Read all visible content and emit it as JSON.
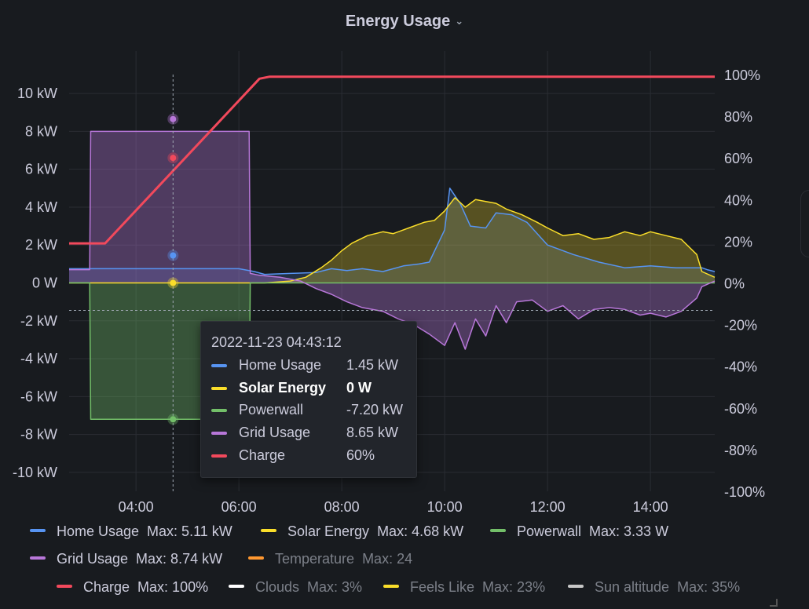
{
  "panel": {
    "title": "Energy Usage"
  },
  "chart_data": {
    "type": "line",
    "x_ticks": [
      "04:00",
      "06:00",
      "08:00",
      "10:00",
      "12:00",
      "14:00"
    ],
    "x_tick_hours": [
      4,
      6,
      8,
      10,
      12,
      14
    ],
    "x_range": [
      2.7,
      15.25
    ],
    "y_left": {
      "ticks": [
        "10 kW",
        "8 kW",
        "6 kW",
        "4 kW",
        "2 kW",
        "0 W",
        "-2 kW",
        "-4 kW",
        "-6 kW",
        "-8 kW",
        "-10 kW"
      ],
      "range_kw": [
        -11,
        11
      ]
    },
    "y_right": {
      "ticks": [
        "100%",
        "80%",
        "60%",
        "40%",
        "20%",
        "0%",
        "-20%",
        "-40%",
        "-60%",
        "-80%",
        "-100%"
      ],
      "range_pct": [
        -100,
        100
      ]
    },
    "hover_hour": 4.72,
    "hover_threshold_kw": -1.45,
    "series": [
      {
        "name": "Home Usage",
        "color": "#5794f2",
        "unit": "kW",
        "x": [
          2.7,
          3.1,
          3.2,
          4.0,
          5.0,
          6.0,
          6.3,
          6.5,
          7.0,
          7.5,
          7.8,
          8.1,
          8.4,
          8.8,
          9.2,
          9.5,
          9.7,
          10.0,
          10.1,
          10.3,
          10.5,
          10.8,
          11.0,
          11.3,
          11.6,
          12.0,
          12.5,
          13.0,
          13.5,
          14.0,
          14.5,
          14.8,
          15.0,
          15.1,
          15.25
        ],
        "y": [
          0.75,
          0.75,
          0.75,
          0.75,
          0.75,
          0.75,
          0.6,
          0.45,
          0.5,
          0.55,
          0.75,
          0.65,
          0.75,
          0.6,
          0.9,
          1.0,
          1.1,
          2.8,
          5.0,
          4.2,
          3.0,
          2.9,
          3.7,
          3.6,
          3.2,
          2.0,
          1.5,
          1.1,
          0.8,
          0.9,
          0.8,
          0.8,
          0.8,
          0.7,
          0.6
        ]
      },
      {
        "name": "Solar Energy",
        "color": "#fade2a",
        "unit": "kW",
        "x": [
          2.7,
          6.5,
          7.0,
          7.3,
          7.6,
          7.8,
          8.0,
          8.2,
          8.5,
          8.8,
          9.0,
          9.3,
          9.6,
          9.8,
          10.0,
          10.2,
          10.4,
          10.6,
          10.8,
          11.0,
          11.2,
          11.5,
          11.8,
          12.0,
          12.3,
          12.6,
          12.9,
          13.2,
          13.5,
          13.8,
          14.0,
          14.3,
          14.6,
          14.9,
          15.0,
          15.25
        ],
        "y": [
          0,
          0,
          0.1,
          0.3,
          0.8,
          1.2,
          1.7,
          2.1,
          2.5,
          2.7,
          2.6,
          2.9,
          3.2,
          3.3,
          3.8,
          4.5,
          4.0,
          4.4,
          4.3,
          4.2,
          3.9,
          3.6,
          3.2,
          2.9,
          2.5,
          2.6,
          2.3,
          2.4,
          2.7,
          2.5,
          2.7,
          2.5,
          2.3,
          1.5,
          0.6,
          0.3
        ]
      },
      {
        "name": "Powerwall",
        "color": "#73bf69",
        "unit": "kW",
        "x": [
          2.7,
          3.1,
          3.12,
          6.2,
          6.22,
          15.25
        ],
        "y": [
          0,
          0,
          -7.2,
          -7.2,
          0,
          0
        ]
      },
      {
        "name": "Grid Usage",
        "color": "#b877d9",
        "unit": "kW",
        "x": [
          2.7,
          3.1,
          3.12,
          6.2,
          6.22,
          6.4,
          6.8,
          7.2,
          7.5,
          7.8,
          8.1,
          8.4,
          8.8,
          9.1,
          9.4,
          9.7,
          10.0,
          10.2,
          10.4,
          10.6,
          10.8,
          11.0,
          11.2,
          11.4,
          11.7,
          12.0,
          12.3,
          12.6,
          12.9,
          13.2,
          13.5,
          13.8,
          14.0,
          14.3,
          14.6,
          14.9,
          15.0,
          15.25
        ],
        "y": [
          0.7,
          0.7,
          8.0,
          8.0,
          0.5,
          0.4,
          0.3,
          0.1,
          -0.3,
          -0.6,
          -1.0,
          -1.3,
          -1.5,
          -1.9,
          -2.2,
          -2.7,
          -3.3,
          -2.1,
          -3.5,
          -1.9,
          -2.8,
          -1.2,
          -2.1,
          -1.0,
          -0.9,
          -1.5,
          -1.2,
          -1.9,
          -1.4,
          -1.3,
          -1.4,
          -1.7,
          -1.6,
          -1.8,
          -1.5,
          -0.8,
          -0.2,
          0.1
        ]
      },
      {
        "name": "Charge",
        "color": "#f2495c",
        "unit": "%",
        "axis": "right",
        "x": [
          2.7,
          3.4,
          6.4,
          6.6,
          7.0,
          15.25
        ],
        "y": [
          19,
          19,
          98,
          99,
          99,
          99
        ]
      }
    ],
    "tooltip": {
      "time": "2022-11-23 04:43:12",
      "rows": [
        {
          "name": "Home Usage",
          "value": "1.45 kW",
          "color": "#5794f2",
          "highlight": false
        },
        {
          "name": "Solar Energy",
          "value": "0 W",
          "color": "#fade2a",
          "highlight": true
        },
        {
          "name": "Powerwall",
          "value": "-7.20 kW",
          "color": "#73bf69",
          "highlight": false
        },
        {
          "name": "Grid Usage",
          "value": "8.65 kW",
          "color": "#b877d9",
          "highlight": false
        },
        {
          "name": "Charge",
          "value": "60%",
          "color": "#f2495c",
          "highlight": false
        }
      ]
    }
  },
  "legend": [
    {
      "name": "Home Usage",
      "max": "Max: 5.11 kW",
      "color": "#5794f2",
      "enabled": true
    },
    {
      "name": "Solar Energy",
      "max": "Max: 4.68 kW",
      "color": "#fade2a",
      "enabled": true
    },
    {
      "name": "Powerwall",
      "max": "Max: 3.33 W",
      "color": "#73bf69",
      "enabled": true
    },
    {
      "name": "Grid Usage",
      "max": "Max: 8.74 kW",
      "color": "#b877d9",
      "enabled": true
    },
    {
      "name": "Temperature",
      "max": "Max: 24",
      "color": "#ff9830",
      "enabled": false
    },
    {
      "name": "Charge",
      "max": "Max: 100%",
      "color": "#f2495c",
      "enabled": true
    },
    {
      "name": "Clouds",
      "max": "Max: 3%",
      "color": "#ffffff",
      "enabled": false
    },
    {
      "name": "Feels Like",
      "max": "Max: 23%",
      "color": "#fade2a",
      "enabled": false
    },
    {
      "name": "Sun altitude",
      "max": "Max: 35%",
      "color": "#c7c7c7",
      "enabled": false
    }
  ]
}
